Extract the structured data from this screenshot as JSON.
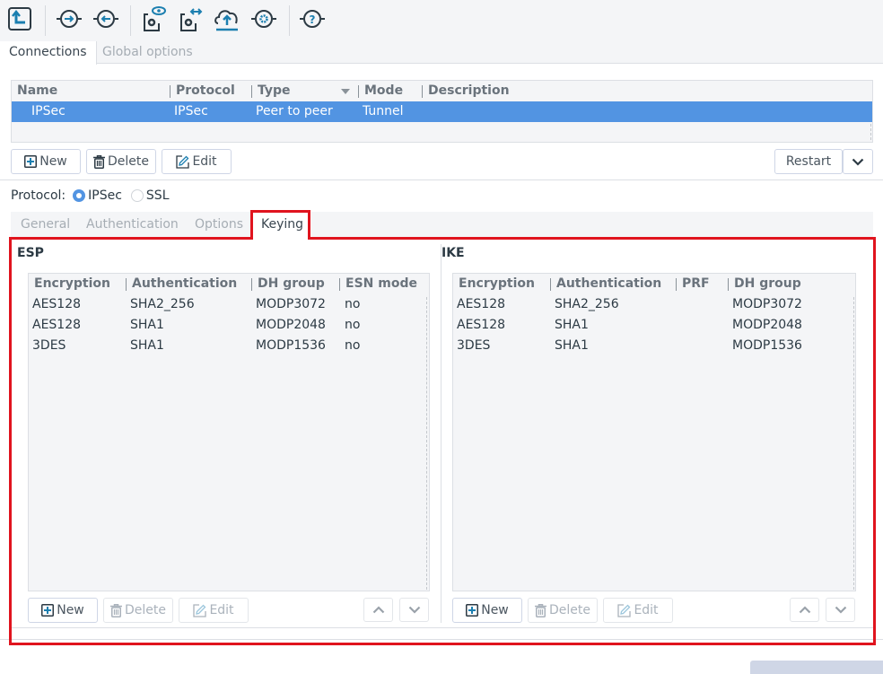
{
  "toolbar": {
    "buttons": [
      {
        "name": "back-icon"
      },
      {
        "name": "connect-icon"
      },
      {
        "name": "disconnect-icon"
      },
      {
        "name": "view-config-icon"
      },
      {
        "name": "transfer-config-icon"
      },
      {
        "name": "upload-icon"
      },
      {
        "name": "settings-icon"
      },
      {
        "name": "help-icon"
      }
    ]
  },
  "top_tabs": [
    {
      "label": "Connections",
      "active": true
    },
    {
      "label": "Global options",
      "active": false
    }
  ],
  "connections": {
    "columns": [
      "Name",
      "Protocol",
      "Type",
      "Mode",
      "Description"
    ],
    "rows": [
      {
        "name": "IPSec",
        "protocol": "IPSec",
        "type": "Peer to peer",
        "mode": "Tunnel",
        "description": ""
      }
    ],
    "buttons": {
      "new": "New",
      "delete": "Delete",
      "edit": "Edit",
      "restart": "Restart"
    }
  },
  "protocol": {
    "label": "Protocol:",
    "options": [
      {
        "label": "IPSec",
        "selected": true
      },
      {
        "label": "SSL",
        "selected": false
      }
    ]
  },
  "sub_tabs": [
    {
      "label": "General",
      "active": false
    },
    {
      "label": "Authentication",
      "active": false
    },
    {
      "label": "Options",
      "active": false
    },
    {
      "label": "Keying",
      "active": true
    }
  ],
  "esp": {
    "title": "ESP",
    "columns": [
      "Encryption",
      "Authentication",
      "DH group",
      "ESN mode"
    ],
    "rows": [
      [
        "AES128",
        "SHA2_256",
        "MODP3072",
        "no"
      ],
      [
        "AES128",
        "SHA1",
        "MODP2048",
        "no"
      ],
      [
        "3DES",
        "SHA1",
        "MODP1536",
        "no"
      ]
    ],
    "buttons": {
      "new": "New",
      "delete": "Delete",
      "edit": "Edit"
    }
  },
  "ike": {
    "title": "IKE",
    "columns": [
      "Encryption",
      "Authentication",
      "PRF",
      "DH group"
    ],
    "rows": [
      [
        "AES128",
        "SHA2_256",
        "",
        "MODP3072"
      ],
      [
        "AES128",
        "SHA1",
        "",
        "MODP2048"
      ],
      [
        "3DES",
        "SHA1",
        "",
        "MODP1536"
      ]
    ],
    "buttons": {
      "new": "New",
      "delete": "Delete",
      "edit": "Edit"
    }
  },
  "colors": {
    "accent": "#5294e2",
    "highlight_border": "#e0141e",
    "icon_teal": "#1c7fb0",
    "icon_dark": "#2c3a44"
  }
}
